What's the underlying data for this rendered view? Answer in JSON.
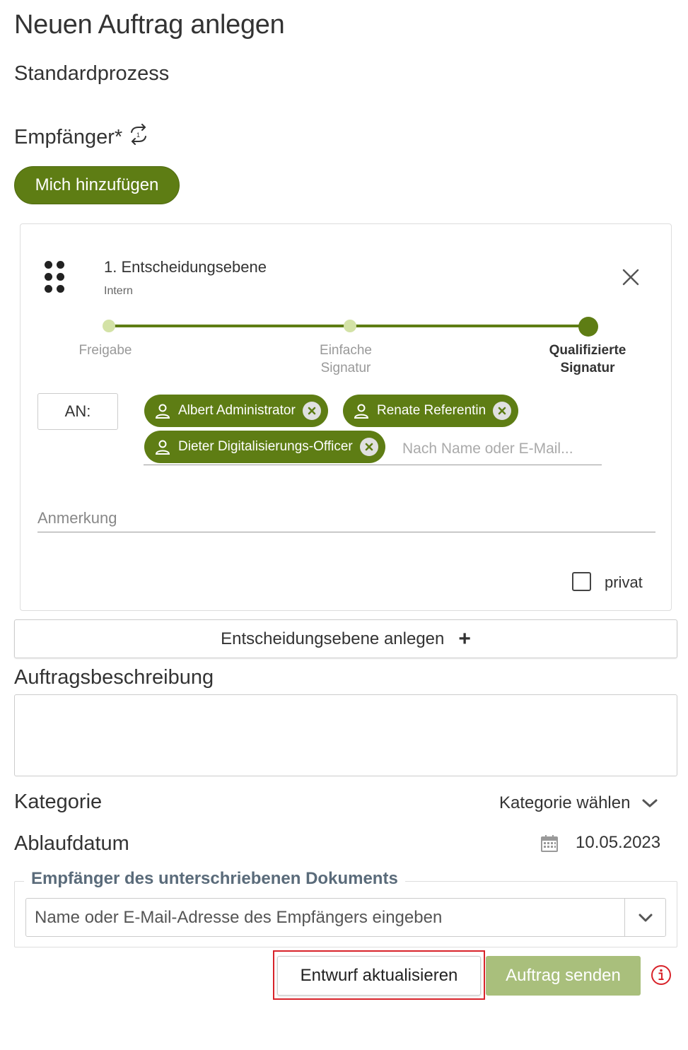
{
  "page": {
    "title": "Neuen Auftrag anlegen",
    "subtitle": "Standardprozess"
  },
  "recipients": {
    "heading": "Empfänger*",
    "switch_icon": "swap-arrows-icon",
    "add_me_label": "Mich hinzufügen"
  },
  "level": {
    "title": "1. Entscheidungsebene",
    "subtitle": "Intern",
    "drag_icon": "drag-handle-icon",
    "close_icon": "close-icon",
    "steps": [
      {
        "label_line1": "Freigabe",
        "label_line2": "",
        "active": false
      },
      {
        "label_line1": "Einfache",
        "label_line2": "Signatur",
        "active": false
      },
      {
        "label_line1": "Qualifizierte",
        "label_line2": "Signatur",
        "active": true
      }
    ],
    "to_label": "AN:",
    "chips": [
      {
        "name": "Albert Administrator"
      },
      {
        "name": "Renate Referentin"
      },
      {
        "name": "Dieter Digitalisierungs-Officer"
      }
    ],
    "search_placeholder": "Nach Name oder E-Mail...",
    "note_placeholder": "Anmerkung",
    "private_label": "privat",
    "private_checked": false
  },
  "add_level": {
    "label": "Entscheidungsebene anlegen",
    "plus": "+"
  },
  "description": {
    "heading": "Auftragsbeschreibung",
    "value": ""
  },
  "category": {
    "label": "Kategorie",
    "select_label": "Kategorie wählen"
  },
  "expiry": {
    "label": "Ablaufdatum",
    "value": "10.05.2023",
    "icon": "calendar-icon"
  },
  "signed_doc_recipients": {
    "legend": "Empfänger des unterschriebenen Dokuments",
    "placeholder": "Name oder E-Mail-Adresse des Empfängers eingeben"
  },
  "actions": {
    "draft_label": "Entwurf aktualisieren",
    "send_label": "Auftrag senden",
    "info_icon": "info-icon"
  },
  "colors": {
    "primary": "#5e7d14",
    "primary_light": "#d3e2a6",
    "send_disabled": "#a9bf7c",
    "highlight": "#d8232a",
    "info": "#d8232a"
  }
}
